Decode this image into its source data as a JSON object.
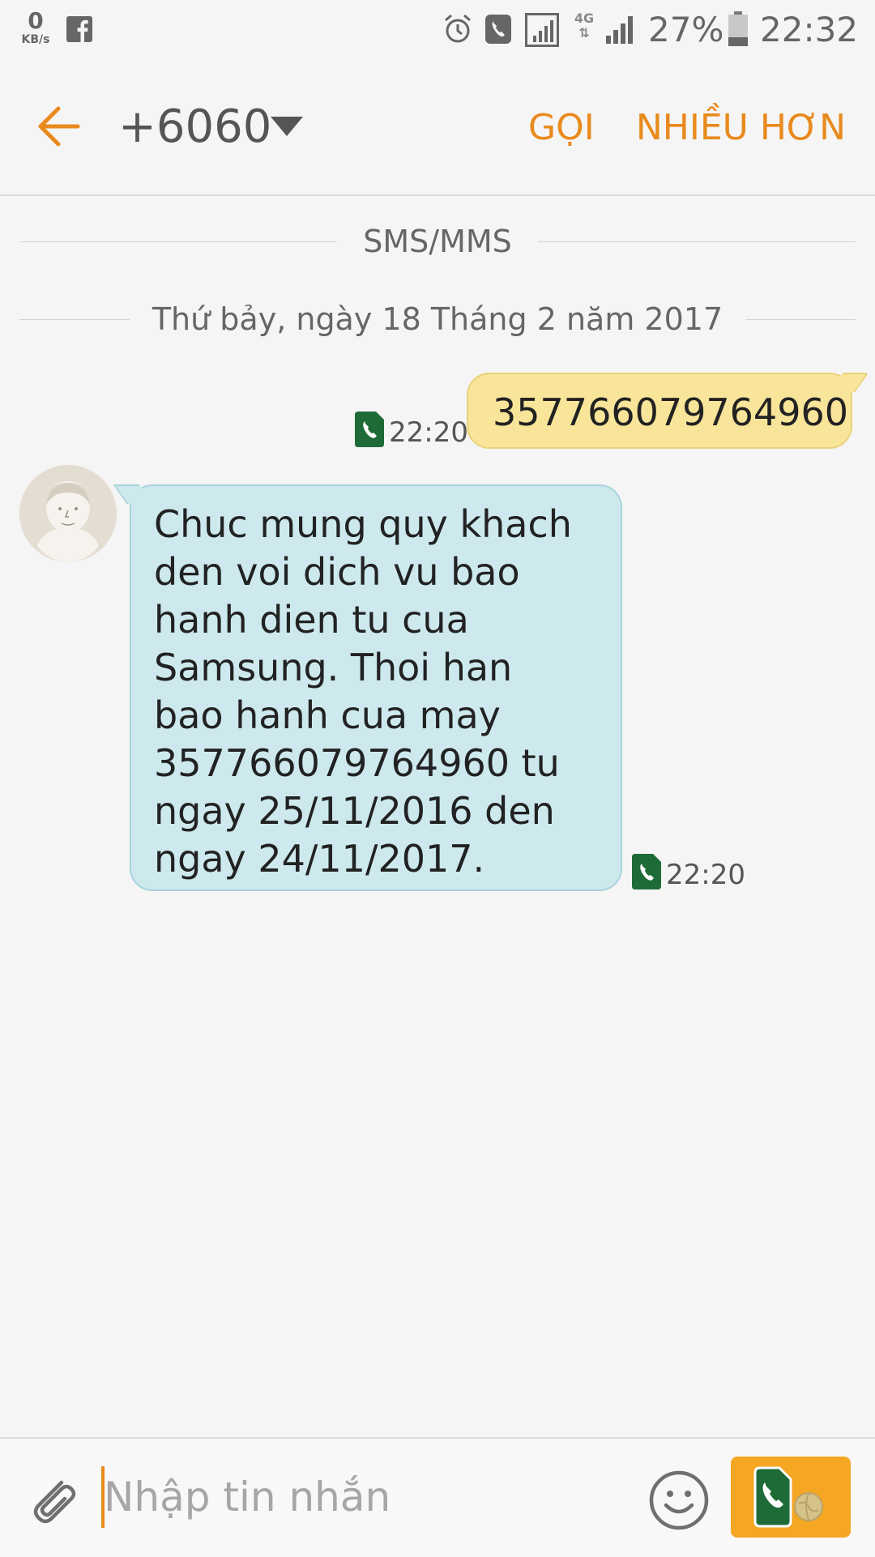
{
  "status_bar": {
    "net_speed_value": "0",
    "net_speed_unit": "KB/s",
    "network_type": "4G",
    "battery_percent": "27%",
    "time": "22:32",
    "icons": [
      "facebook-icon",
      "alarm-icon",
      "call-icon",
      "signal-sim1-icon",
      "4g-data-icon",
      "signal-sim2-icon",
      "battery-icon"
    ]
  },
  "header": {
    "contact": "+6060",
    "call_label": "GỌI",
    "more_label": "NHIỀU HƠN"
  },
  "conversation": {
    "channel_label": "SMS/MMS",
    "date_label": "Thứ bảy, ngày 18 Tháng 2 năm 2017",
    "messages": [
      {
        "direction": "sent",
        "text": "357766079764960",
        "time": "22:20"
      },
      {
        "direction": "received",
        "text": "Chuc mung quy khach\nden voi dich vu bao\nhanh dien tu cua\nSamsung. Thoi han\nbao hanh cua may\n357766079764960 tu\nngay 25/11/2016 den\nngay 24/11/2017.",
        "time": "22:20"
      }
    ]
  },
  "composer": {
    "placeholder": "Nhập tin nhắn",
    "value": ""
  },
  "colors": {
    "accent": "#e98a1d",
    "sent_bubble": "#f8e59a",
    "received_bubble": "#cde9ee",
    "send_button": "#f5a623",
    "sim_icon": "#1e6b37"
  }
}
